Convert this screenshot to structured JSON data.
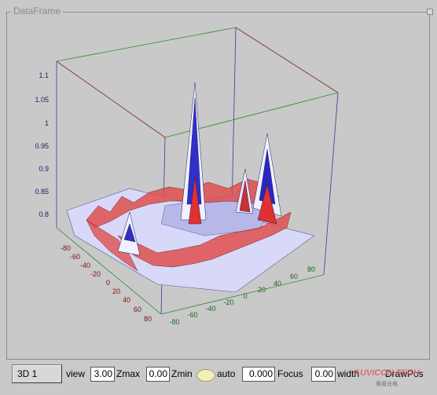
{
  "frame": {
    "title": "DataFrame"
  },
  "plot": {
    "z_ticks": [
      "1.1",
      "1.05",
      "1",
      "0.95",
      "0.9",
      "0.85",
      "0.8"
    ],
    "y_ticks": [
      "-80",
      "-60",
      "-40",
      "-20",
      "0",
      "20",
      "40",
      "60",
      "80"
    ],
    "x_ticks": [
      "-80",
      "-60",
      "-40",
      "-20",
      "0",
      "20",
      "40",
      "60",
      "80"
    ],
    "colors": {
      "peak": "#1010c0",
      "mid": "#e8e8ff",
      "base": "#d02020",
      "grid": "#2a7a2a",
      "box": "#7a2a2a"
    }
  },
  "toolbar": {
    "mode_button": "3D 1",
    "view_label": "view",
    "zmax_value": "3.00",
    "zmax_label": "Zmax",
    "zmin_value": "0.00",
    "zmin_label": "Zmin",
    "auto_label": "auto",
    "focus_value": "0.000",
    "focus_label": "Focus",
    "width_value": "0.00",
    "width_label": "width",
    "draw_label": "DrawPos"
  },
  "logo": {
    "text": "AUVICON TECH",
    "subtext": "奥普光电"
  }
}
